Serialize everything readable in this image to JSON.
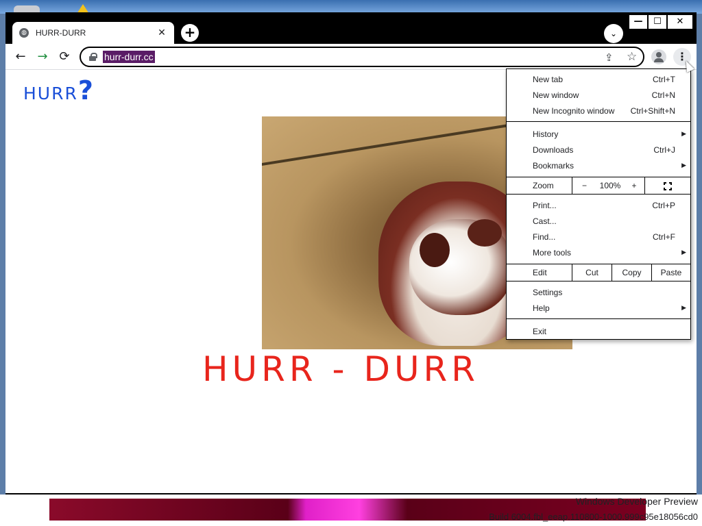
{
  "window": {
    "tab_title": "HURR-DURR",
    "tab_close": "✕",
    "new_tab": "+",
    "tab_search": "⌄",
    "minimize": "—",
    "maximize": "☐",
    "close": "✕"
  },
  "toolbar": {
    "back": "←",
    "forward": "→",
    "reload": "⟳",
    "url": "hurr-durr.cc",
    "share": "⇪",
    "star": "☆",
    "menu": "⋮"
  },
  "page": {
    "logo_text": "HURR",
    "logo_mark": "?",
    "headline": "HURR - DURR"
  },
  "menu": {
    "new_tab": {
      "label": "New tab",
      "shortcut": "Ctrl+T"
    },
    "new_window": {
      "label": "New window",
      "shortcut": "Ctrl+N"
    },
    "new_incognito": {
      "label": "New Incognito window",
      "shortcut": "Ctrl+Shift+N"
    },
    "history": {
      "label": "History"
    },
    "downloads": {
      "label": "Downloads",
      "shortcut": "Ctrl+J"
    },
    "bookmarks": {
      "label": "Bookmarks"
    },
    "zoom": {
      "label": "Zoom",
      "minus": "−",
      "level": "100%",
      "plus": "+"
    },
    "print": {
      "label": "Print...",
      "shortcut": "Ctrl+P"
    },
    "cast": {
      "label": "Cast..."
    },
    "find": {
      "label": "Find...",
      "shortcut": "Ctrl+F"
    },
    "more_tools": {
      "label": "More tools"
    },
    "edit": {
      "label": "Edit",
      "cut": "Cut",
      "copy": "Copy",
      "paste": "Paste"
    },
    "settings": {
      "label": "Settings"
    },
    "help": {
      "label": "Help"
    },
    "exit": {
      "label": "Exit"
    },
    "submenu_arrow": "▶"
  },
  "watermark": {
    "line1": "Windows Developer Preview",
    "line2": "Build 6004.fbl_eeap.110800-1000.999c95e18056cd0"
  }
}
